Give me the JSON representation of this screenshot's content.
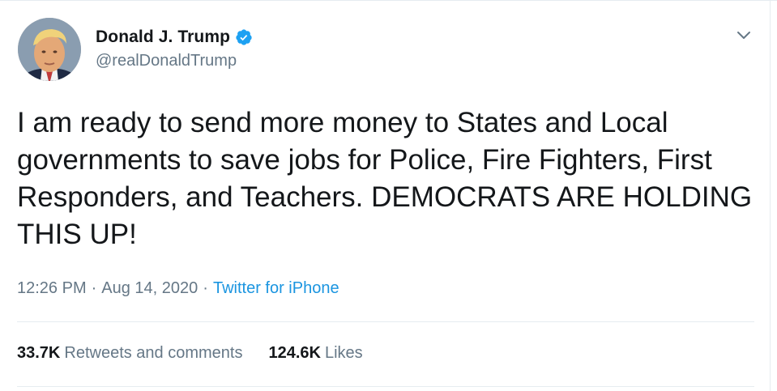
{
  "tweet": {
    "author": {
      "display_name": "Donald J. Trump",
      "handle": "@realDonaldTrump",
      "verified": true
    },
    "text": "I am ready to send more money to States and Local governments to save jobs for Police, Fire Fighters, First Responders, and Teachers. DEMOCRATS ARE HOLDING THIS UP!",
    "time": "12:26 PM",
    "date": "Aug 14, 2020",
    "separator": "·",
    "source": "Twitter for iPhone",
    "stats": {
      "retweets_count": "33.7K",
      "retweets_label": "Retweets and comments",
      "likes_count": "124.6K",
      "likes_label": "Likes"
    }
  },
  "colors": {
    "text": "#14171a",
    "secondary": "#657786",
    "link": "#1b95e0",
    "verified": "#1da1f2",
    "divider": "#e6ecf0"
  },
  "icons": {
    "verified": "verified-badge-icon",
    "menu": "chevron-down-icon"
  }
}
